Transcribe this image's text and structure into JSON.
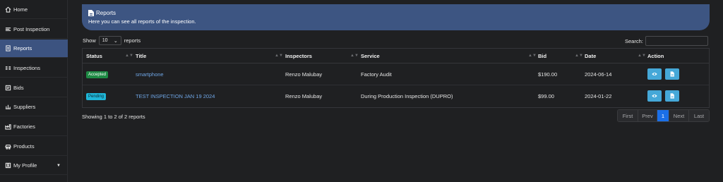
{
  "sidebar": {
    "items": [
      {
        "label": "Home",
        "icon": "home-icon"
      },
      {
        "label": "Post Inspection",
        "icon": "post-icon"
      },
      {
        "label": "Reports",
        "icon": "report-icon",
        "active": true
      },
      {
        "label": "Inspections",
        "icon": "inspections-icon"
      },
      {
        "label": "Bids",
        "icon": "bids-icon"
      },
      {
        "label": "Suppliers",
        "icon": "suppliers-icon"
      },
      {
        "label": "Factories",
        "icon": "factory-icon"
      },
      {
        "label": "Products",
        "icon": "products-icon"
      },
      {
        "label": "My Profile",
        "icon": "profile-icon"
      }
    ]
  },
  "banner": {
    "title": "Reports",
    "subtitle": "Here you can see all reports of the inspection."
  },
  "controls": {
    "show_label": "Show",
    "show_value": "10",
    "show_suffix": "reports",
    "search_label": "Search:"
  },
  "table": {
    "headers": [
      "Status",
      "Title",
      "Inspectors",
      "Service",
      "Bid",
      "Date",
      "Action"
    ],
    "rows": [
      {
        "status": "Accepted",
        "title": "smartphone",
        "inspector": "Renzo Malubay",
        "service": "Factory Audit",
        "bid": "$190.00",
        "date": "2024-06-14"
      },
      {
        "status": "Pending",
        "title": "TEST INSPECTION JAN 19 2024",
        "inspector": "Renzo Malubay",
        "service": "During Production Inspection (DUPRO)",
        "bid": "$99.00",
        "date": "2024-01-22"
      }
    ]
  },
  "footer": {
    "showing": "Showing 1 to 2 of 2 reports",
    "pager": [
      "First",
      "Prev",
      "1",
      "Next",
      "Last"
    ]
  },
  "colors": {
    "accent": "#3d5582",
    "accepted": "#1e8a44",
    "pending": "#1fb6d8",
    "action": "#45a8d8",
    "page_active": "#1a6fe8"
  }
}
